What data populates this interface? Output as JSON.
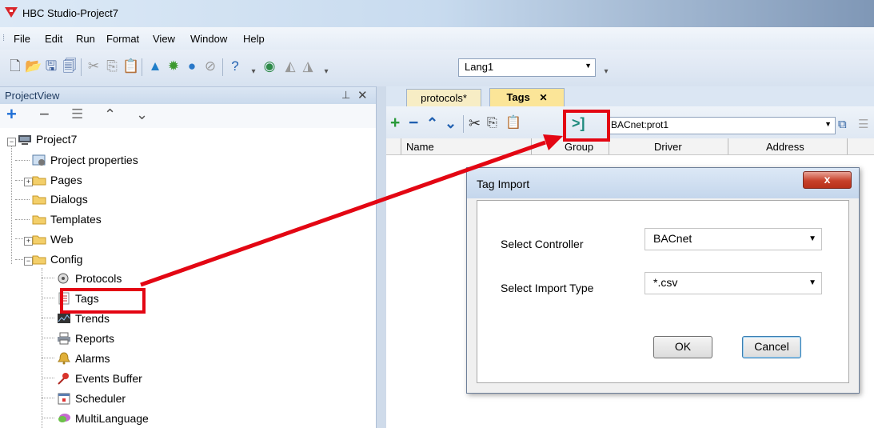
{
  "window": {
    "title": "HBC Studio-Project7"
  },
  "menu": [
    "File",
    "Edit",
    "Run",
    "Format",
    "View",
    "Window",
    "Help"
  ],
  "toolbar": {
    "language": "Lang1"
  },
  "project_view": {
    "title": "ProjectView",
    "tree": {
      "root": "Project7",
      "items": [
        "Project properties",
        "Pages",
        "Dialogs",
        "Templates",
        "Web",
        "Config",
        "Protocols",
        "Tags",
        "Trends",
        "Reports",
        "Alarms",
        "Events Buffer",
        "Scheduler",
        "MultiLanguage"
      ]
    }
  },
  "tabs": [
    {
      "label": "protocols*",
      "active": false
    },
    {
      "label": "Tags",
      "active": true
    }
  ],
  "tags_editor": {
    "protocol": "BACnet:prot1",
    "columns": [
      "Name",
      "Group",
      "Driver",
      "Address"
    ]
  },
  "dialog": {
    "title": "Tag Import",
    "close": "x",
    "controller_label": "Select Controller",
    "controller_value": "BACnet",
    "import_type_label": "Select Import Type",
    "import_type_value": "*.csv",
    "ok": "OK",
    "cancel": "Cancel"
  },
  "colors": {
    "annotation": "#e30613",
    "accent": "#1e3a5f"
  }
}
